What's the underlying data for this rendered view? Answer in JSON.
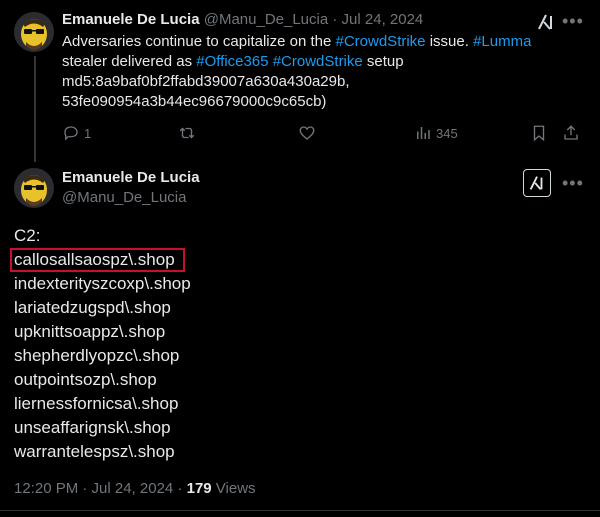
{
  "tweet1": {
    "name": "Emanuele De Lucia",
    "handle": "@Manu_De_Lucia",
    "separator": "·",
    "date": "Jul 24, 2024",
    "text_parts": [
      "Adversaries continue to capitalize on the ",
      "#CrowdStrike",
      " issue. ",
      "#Lumma",
      "stealer delivered as ",
      "#Office365",
      " ",
      "#CrowdStrike",
      " setup",
      "md5:8a9baf0bf2ffabd39007a630a430a29b,",
      "53fe090954a3b44ec96679000c9c65cb)"
    ],
    "actions": {
      "replies": "1",
      "views": "345"
    }
  },
  "tweet2": {
    "name": "Emanuele De Lucia",
    "handle": "@Manu_De_Lucia",
    "body": {
      "heading": "C2:",
      "domains": [
        "callosallsaospz\\.shop",
        "indexterityszcoxp\\.shop",
        "lariatedzugspd\\.shop",
        "upknittsoappz\\.shop",
        "shepherdlyopzc\\.shop",
        "outpointsozp\\.shop",
        "liernessfornicsa\\.shop",
        "unseaffarignsk\\.shop",
        "warrantelespsz\\.shop"
      ]
    },
    "footer": {
      "time_date": "12:20 PM · Jul 24, 2024 · ",
      "views_count": "179",
      "views_label": " Views"
    }
  },
  "colors": {
    "background": "#000000",
    "text": "#e7e9ea",
    "muted": "#71767b",
    "link": "#1d9bf0",
    "highlight_box": "#c8102e"
  },
  "icons": [
    "avatar",
    "grok-icon",
    "more-icon",
    "reply-icon",
    "retweet-icon",
    "like-icon",
    "views-icon",
    "bookmark-icon",
    "share-icon"
  ]
}
